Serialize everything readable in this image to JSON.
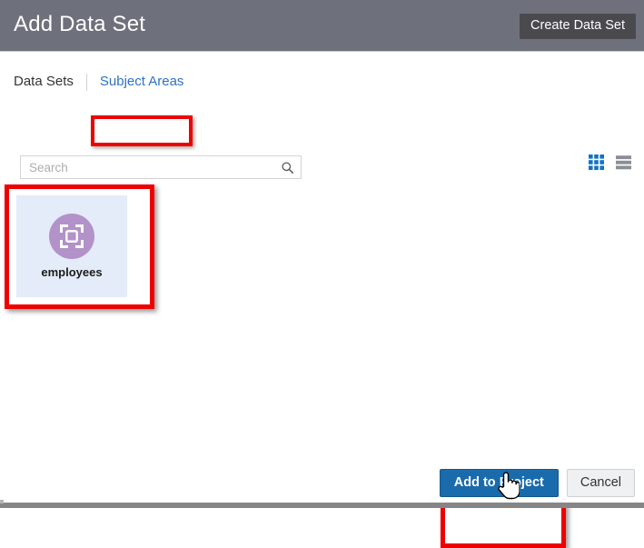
{
  "header": {
    "title": "Add Data Set",
    "create_button": "Create Data Set",
    "background_color": "#6e707c",
    "button_color": "#4a4a4e"
  },
  "tabs": [
    {
      "label": "Data Sets",
      "active": true,
      "name": "tab-data-sets"
    },
    {
      "label": "Subject Areas",
      "active": false,
      "name": "tab-subject-areas",
      "link_color": "#2f72c4",
      "highlighted": true
    }
  ],
  "search": {
    "placeholder": "Search",
    "value": "",
    "icon": "search-icon"
  },
  "view_toggles": [
    {
      "name": "grid-view-toggle",
      "icon": "grid-icon",
      "active": true,
      "color": "#1072c6"
    },
    {
      "name": "list-view-toggle",
      "icon": "list-icon",
      "active": false,
      "color": "#8b8f95"
    }
  ],
  "items": [
    {
      "label": "employees",
      "icon": "subject-area-icon",
      "icon_color": "#b292c9",
      "selected": true,
      "tile_color": "#e3ecf8",
      "highlighted": true
    }
  ],
  "footer": {
    "primary_button": "Add to Project",
    "primary_color": "#1a6bab",
    "secondary_button": "Cancel",
    "primary_highlighted": true
  },
  "annotations": {
    "highlight_color": "#ef0000",
    "cursor": "pointer-hand-cursor"
  }
}
